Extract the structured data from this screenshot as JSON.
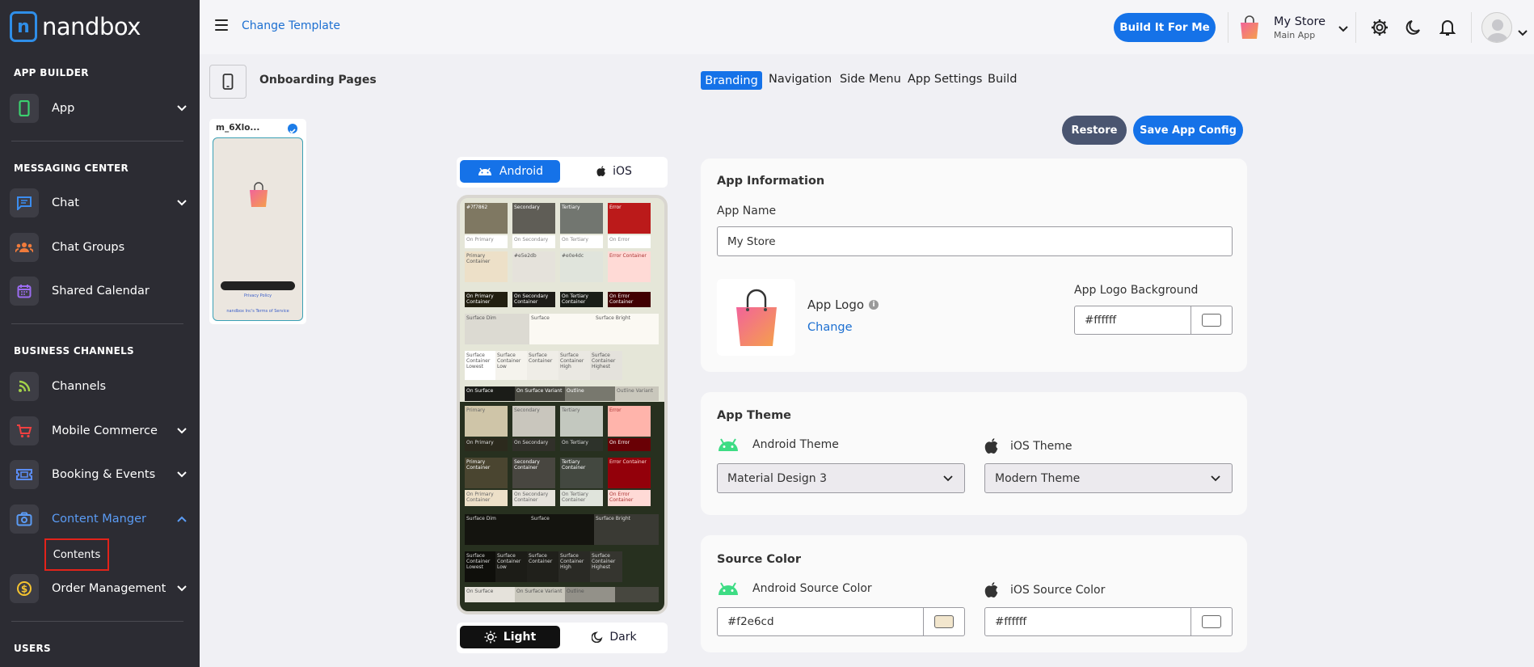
{
  "brand": {
    "logo_letter": "n",
    "name": "nandbox"
  },
  "sidebar": {
    "sections": {
      "app_builder": "APP BUILDER",
      "messaging": "MESSAGING CENTER",
      "business": "BUSINESS CHANNELS",
      "users": "USERS"
    },
    "items": {
      "app": "App",
      "chat": "Chat",
      "chat_groups": "Chat Groups",
      "shared_calendar": "Shared Calendar",
      "channels": "Channels",
      "mobile_commerce": "Mobile Commerce",
      "booking": "Booking & Events",
      "content_manager": "Content Manger",
      "contents": "Contents",
      "order_management": "Order Management"
    },
    "colors": {
      "active": "#5b9cf5",
      "highlight_border": "#e2231a"
    }
  },
  "header": {
    "change_template": "Change Template",
    "build_button": "Build It For Me",
    "store_name": "My Store",
    "store_subtitle": "Main App"
  },
  "left_panel": {
    "title": "Onboarding Pages",
    "thumb_name": "m_6Xlo...",
    "thumb_privacy": "Privacy Policy",
    "thumb_terms": "nandbox Inc's Terms of Service"
  },
  "preview": {
    "platforms": {
      "android": "Android",
      "ios": "iOS"
    },
    "modes": {
      "light": "Light",
      "dark": "Dark"
    },
    "light_labels": {
      "primary": "#7f7862",
      "secondary": "Secondary",
      "tertiary": "Tertiary",
      "error": "Error",
      "on_primary": "On Primary",
      "on_secondary": "On Secondary",
      "on_tertiary": "On Tertiary",
      "on_error": "On Error",
      "primary_container": "Primary Container",
      "secondary_container": "#e5e2db",
      "tertiary_container": "#e0e4dc",
      "error_container": "Error Container",
      "on_primary_container": "On Primary Container",
      "on_secondary_container": "On Secondary Container",
      "on_tertiary_container": "On Tertiary Container",
      "on_error_container": "On Error Container",
      "surface_dim": "Surface Dim",
      "surface": "Surface",
      "surface_bright": "Surface Bright",
      "sc_lowest": "Surface Container Lowest",
      "sc_low": "Surface Container Low",
      "sc": "Surface Container",
      "sc_high": "Surface Container High",
      "sc_highest": "Surface Container Highest",
      "on_surface": "On Surface",
      "on_surface_variant": "On Surface Variant",
      "outline": "Outline",
      "outline_variant": "Outline Variant"
    },
    "dark_labels": {
      "primary": "Primary",
      "secondary": "Secondary",
      "tertiary": "Tertiary",
      "error": "Error",
      "on_primary": "On Primary",
      "on_secondary": "On Secondary",
      "on_tertiary": "On Tertiary",
      "on_error": "On Error",
      "primary_container": "Primary Container",
      "secondary_container": "Secondary Container",
      "tertiary_container": "Tertiary Container",
      "error_container": "Error Container",
      "on_primary_container": "On Primary Container",
      "on_secondary_container": "On Secondary Container",
      "on_tertiary_container": "On Tertiary Container",
      "on_error_container": "On Error Container",
      "surface_dim": "Surface Dim",
      "surface": "Surface",
      "surface_bright": "Surface Bright",
      "sc_lowest": "Surface Container Lowest",
      "sc_low": "Surface Container Low",
      "sc": "Surface Container",
      "sc_high": "Surface Container High",
      "sc_highest": "Surface Container Highest",
      "on_surface": "On Surface",
      "on_surface_variant": "On Surface Variant",
      "outline": "Outline"
    }
  },
  "tabs": [
    "Branding",
    "Navigation",
    "Side Menu",
    "App Settings",
    "Build"
  ],
  "actions": {
    "restore": "Restore",
    "save": "Save App Config"
  },
  "app_info": {
    "title": "App Information",
    "name_label": "App Name",
    "name_value": "My Store",
    "logo_label": "App Logo",
    "logo_change": "Change",
    "logo_bg_label": "App Logo Background",
    "logo_bg_value": "#ffffff",
    "logo_bg_color": "#ffffff"
  },
  "app_theme": {
    "title": "App Theme",
    "android_label": "Android Theme",
    "android_value": "Material Design 3",
    "ios_label": "iOS Theme",
    "ios_value": "Modern Theme"
  },
  "source_color": {
    "title": "Source Color",
    "android_label": "Android Source Color",
    "android_value": "#f2e6cd",
    "android_color": "#f2e6cd",
    "ios_label": "iOS Source Color",
    "ios_value": "#ffffff",
    "ios_color": "#ffffff"
  },
  "icons": [
    "hamburger-icon",
    "gear-icon",
    "moon-icon",
    "bell-icon",
    "avatar-icon",
    "android-icon",
    "apple-icon",
    "sun-icon",
    "info-icon",
    "chevron-down-icon",
    "shopping-bag-icon",
    "check-icon",
    "phone-icon"
  ]
}
